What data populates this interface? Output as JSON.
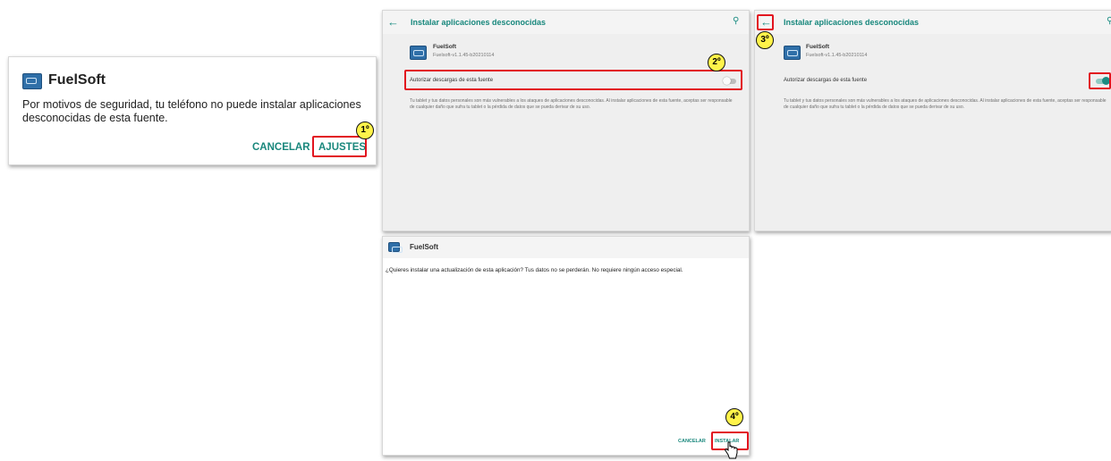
{
  "dialog": {
    "app_name": "FuelSoft",
    "message": "Por motivos de seguridad, tu teléfono no puede instalar aplicaciones desconocidas de esta fuente.",
    "cancel_label": "CANCELAR",
    "settings_label": "AJUSTES",
    "step": "1º"
  },
  "settings_off": {
    "title": "Instalar aplicaciones desconocidas",
    "app_name": "FuelSoft",
    "app_version": "Fuelsoft-v1.1.45-b20210114",
    "toggle_label": "Autorizar descargas de esta fuente",
    "toggle_on": false,
    "description": "Tu tablet y tus datos personales son más vulnerables a los ataques de aplicaciones desconocidas. Al instalar aplicaciones de esta fuente, aceptas ser responsable de cualquier daño que sufra tu tablet o la pérdida de datos que se pueda derivar de su uso.",
    "step": "2º"
  },
  "settings_on": {
    "title": "Instalar aplicaciones desconocidas",
    "app_name": "FuelSoft",
    "app_version": "Fuelsoft-v1.1.45-b20210114",
    "toggle_label": "Autorizar descargas de esta fuente",
    "toggle_on": true,
    "description": "Tu tablet y tus datos personales son más vulnerables a los ataques de aplicaciones desconocidas. Al instalar aplicaciones de esta fuente, aceptas ser responsable de cualquier daño que sufra tu tablet o la pérdida de datos que se pueda derivar de su uso.",
    "step": "3º"
  },
  "installer": {
    "app_name": "FuelSoft",
    "message": "¿Quieres instalar una actualización de esta aplicación? Tus datos no se perderán. No requiere ningún acceso especial.",
    "cancel_label": "CANCELAR",
    "install_label": "INSTALAR",
    "step": "4º"
  },
  "icons": [
    "back-arrow-icon",
    "search-icon",
    "app-icon",
    "hand-cursor-icon"
  ],
  "colors": {
    "accent": "#1b8c82",
    "highlight": "#e2141f",
    "badge": "#fff34a"
  }
}
